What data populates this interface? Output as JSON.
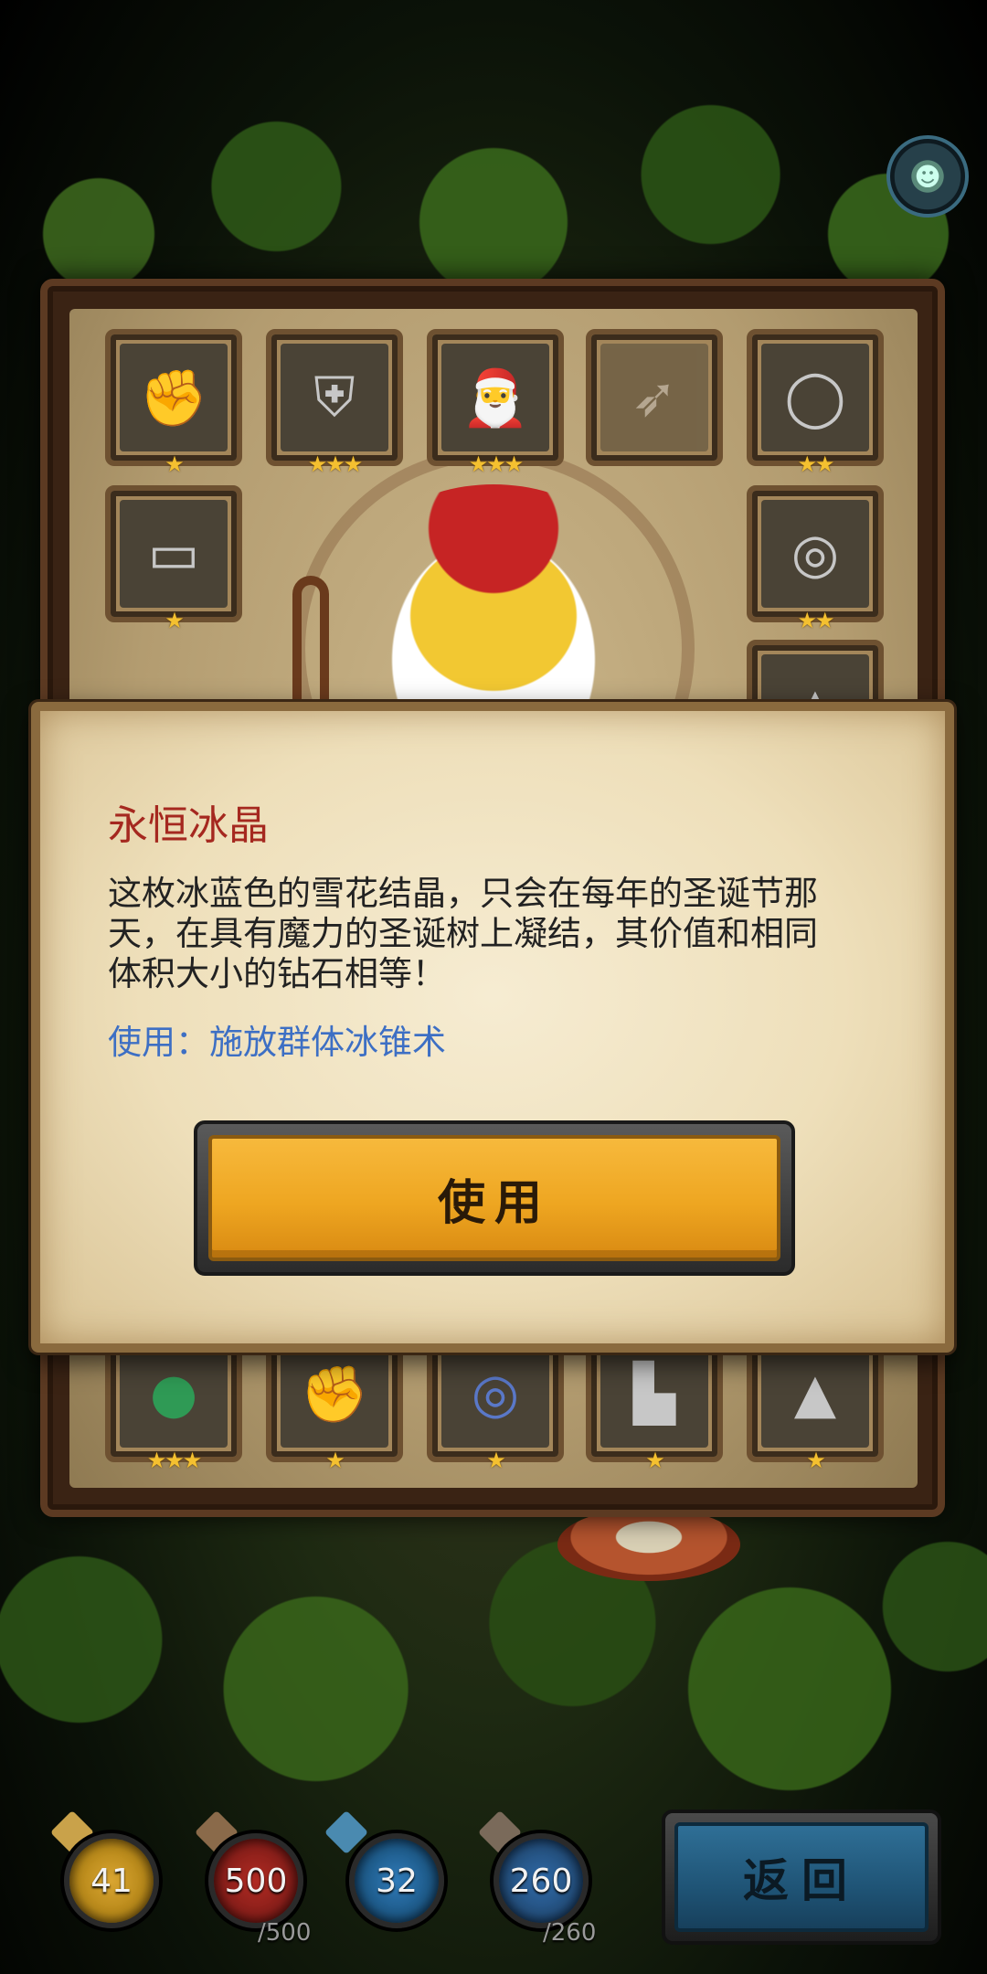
{
  "profile": {
    "icon": "goblin-avatar-icon"
  },
  "inventory": {
    "top_rows": [
      {
        "icon": "gauntlet-icon",
        "glyph": "✊",
        "stars": "★"
      },
      {
        "icon": "armor-icon",
        "glyph": "⛨",
        "stars": "★★★"
      },
      {
        "icon": "santa-hat-icon",
        "glyph": "🎅",
        "stars": "★★★"
      },
      {
        "icon": "crossbow-icon",
        "glyph": "➶",
        "stars": ""
      },
      {
        "icon": "necklace-icon",
        "glyph": "◯",
        "stars": "★★"
      },
      {
        "icon": "belt-icon",
        "glyph": "▭",
        "stars": "★"
      },
      {
        "icon": "ring-icon",
        "glyph": "◎",
        "stars": "★★"
      },
      {
        "icon": "cloak-icon",
        "glyph": "▲",
        "stars": ""
      }
    ],
    "bottom_row": [
      {
        "icon": "green-gem-icon",
        "glyph": "●",
        "stars": "★★★"
      },
      {
        "icon": "gauntlet-icon",
        "glyph": "✊",
        "stars": "★"
      },
      {
        "icon": "blue-ring-icon",
        "glyph": "◎",
        "stars": "★"
      },
      {
        "icon": "boots-icon",
        "glyph": "▙",
        "stars": "★"
      },
      {
        "icon": "hood-cloak-icon",
        "glyph": "▲",
        "stars": "★"
      }
    ]
  },
  "dialog": {
    "title": "永恒冰晶",
    "description": "这枚冰蓝色的雪花结晶，只会在每年的圣诞节那天，在具有魔力的圣诞树上凝结，其价值和相同体积大小的钻石相等！",
    "use_effect": "使用：施放群体冰锥术",
    "use_button": "使用"
  },
  "stats": [
    {
      "name": "attack",
      "icon": "sword-icon",
      "value": "41",
      "max": "",
      "color": "#b8891a"
    },
    {
      "name": "health",
      "icon": "heart-icon",
      "value": "500",
      "max": "/500",
      "color": "#8a1f1a"
    },
    {
      "name": "defense",
      "icon": "shield-icon",
      "value": "32",
      "max": "",
      "color": "#1e5b8a"
    },
    {
      "name": "mana",
      "icon": "mana-icon",
      "value": "260",
      "max": "/260",
      "color": "#24507e"
    }
  ],
  "back_button": "返回"
}
